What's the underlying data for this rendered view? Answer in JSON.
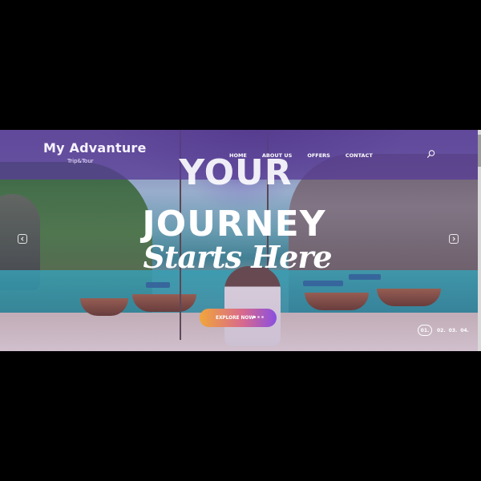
{
  "header": {
    "logo_title": "My Advanture",
    "logo_subtitle": "Trip&Tour",
    "nav": [
      "HOME",
      "ABOUT US",
      "OFFERS",
      "CONTACT"
    ],
    "search_icon": "search-icon"
  },
  "hero": {
    "line1": "YOUR",
    "line2": "JOURNEY",
    "line3": "Starts Here",
    "cta_label": "EXPLORE NOW",
    "prev_icon": "chevron-left-icon",
    "next_icon": "chevron-right-icon"
  },
  "pager": {
    "active": "01.",
    "items": [
      "02.",
      "03.",
      "04."
    ]
  },
  "colors": {
    "header_bg": "#583c96",
    "cta_start": "#f1a53a",
    "cta_end": "#8a4fe0",
    "page_bg": "#000000"
  }
}
